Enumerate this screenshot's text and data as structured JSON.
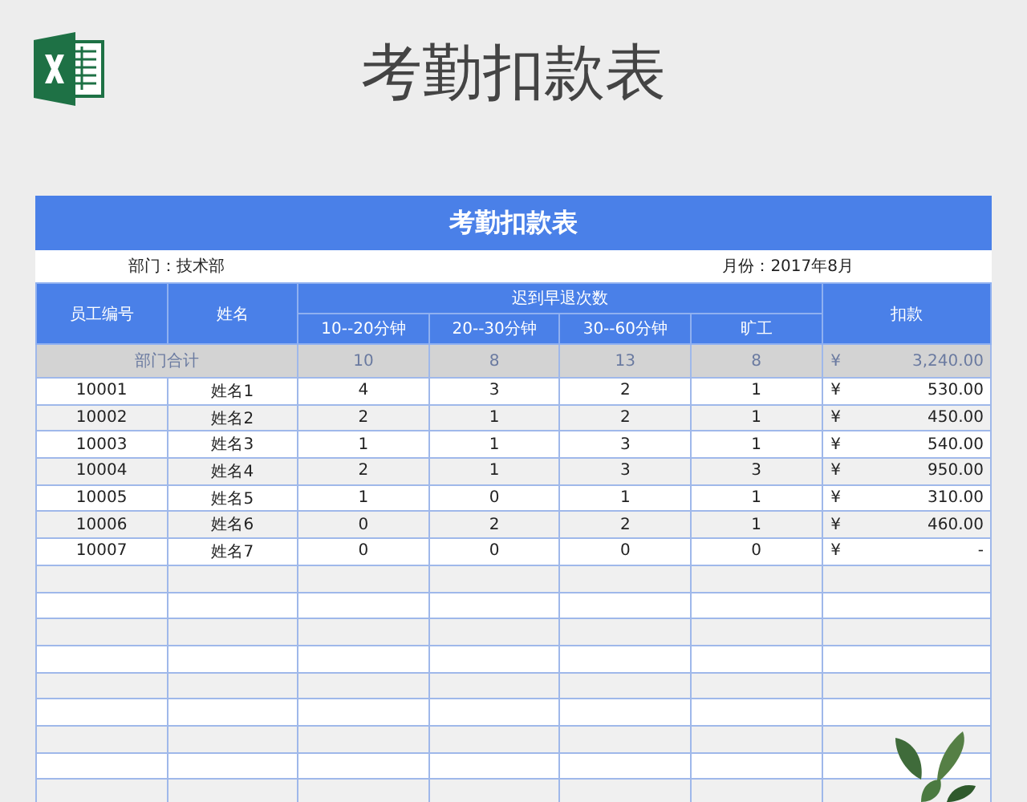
{
  "page_title": "考勤扣款表",
  "sheet": {
    "title": "考勤扣款表",
    "department": "部门：技术部",
    "month": "月份：2017年8月",
    "columns": {
      "id": "员工编号",
      "name": "姓名",
      "group": "迟到早退次数",
      "sub": [
        "10--20分钟",
        "20--30分钟",
        "30--60分钟",
        "旷工"
      ],
      "deduction": "扣款"
    },
    "total": {
      "label": "部门合计",
      "counts": [
        "10",
        "8",
        "13",
        "8"
      ],
      "currency": "¥",
      "amount": "3,240.00"
    },
    "rows": [
      {
        "id": "10001",
        "name": "姓名1",
        "counts": [
          "4",
          "3",
          "2",
          "1"
        ],
        "currency": "¥",
        "amount": "530.00"
      },
      {
        "id": "10002",
        "name": "姓名2",
        "counts": [
          "2",
          "1",
          "2",
          "1"
        ],
        "currency": "¥",
        "amount": "450.00"
      },
      {
        "id": "10003",
        "name": "姓名3",
        "counts": [
          "1",
          "1",
          "3",
          "1"
        ],
        "currency": "¥",
        "amount": "540.00"
      },
      {
        "id": "10004",
        "name": "姓名4",
        "counts": [
          "2",
          "1",
          "3",
          "3"
        ],
        "currency": "¥",
        "amount": "950.00"
      },
      {
        "id": "10005",
        "name": "姓名5",
        "counts": [
          "1",
          "0",
          "1",
          "1"
        ],
        "currency": "¥",
        "amount": "310.00"
      },
      {
        "id": "10006",
        "name": "姓名6",
        "counts": [
          "0",
          "2",
          "2",
          "1"
        ],
        "currency": "¥",
        "amount": "460.00"
      },
      {
        "id": "10007",
        "name": "姓名7",
        "counts": [
          "0",
          "0",
          "0",
          "0"
        ],
        "currency": "¥",
        "amount": "-"
      }
    ]
  }
}
